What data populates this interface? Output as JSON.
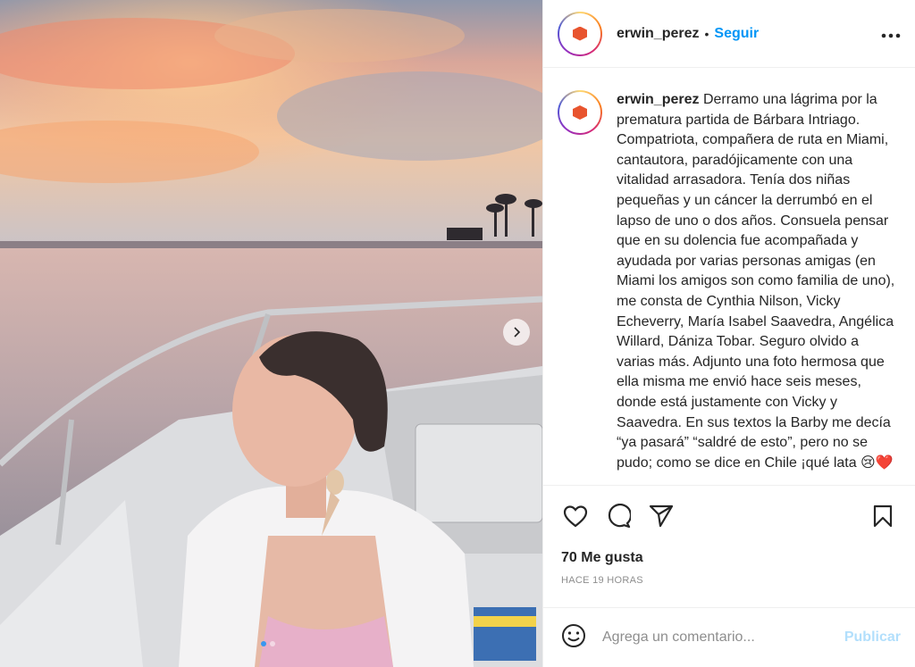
{
  "post": {
    "username": "erwin_perez",
    "separator": "•",
    "follow_label": "Seguir",
    "more_icon": "more-options-icon",
    "avatar_logo_text": "Erwin Pérez",
    "caption_user": "erwin_perez",
    "caption_text": "Derramo una lágrima por la prematura partida de Bárbara Intriago. Compatriota, compañera de ruta en Miami, cantautora, paradójicamente con una vitalidad arrasadora. Tenía dos niñas pequeñas y un cáncer la derrumbó en el lapso de uno o dos años. Consuela pensar que en su dolencia fue acompañada y ayudada por varias personas amigas (en Miami los amigos son como familia de uno), me consta de Cynthia Nilson, Vicky Echeverry, María Isabel Saavedra, Angélica Willard, Dániza Tobar. Seguro olvido a varias más. Adjunto una foto hermosa que ella misma me envió hace seis meses, donde está justamente con Vicky y Saavedra. En sus textos la Barby me decía “ya pasará” “saldré de esto”, pero no se pudo; como se dice en Chile ¡qué lata 😢❤️",
    "likes_text": "70 Me gusta",
    "time_text": "HACE 19 HORAS",
    "comment_placeholder": "Agrega un comentario...",
    "publish_label": "Publicar"
  },
  "carousel": {
    "current": 1,
    "total": 2
  },
  "colors": {
    "link_blue": "#0095f6",
    "publish_disabled": "#b2dffc",
    "muted_text": "#8e8e8e",
    "border": "#efefef"
  }
}
